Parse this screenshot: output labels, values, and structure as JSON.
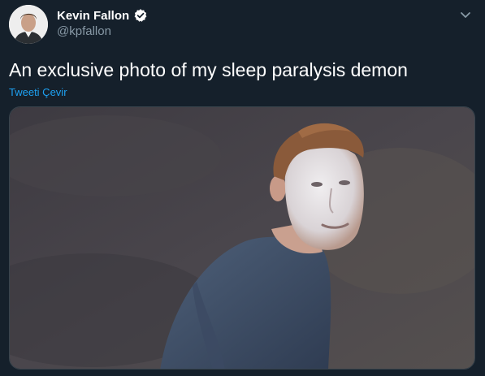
{
  "tweet": {
    "author": {
      "display_name": "Kevin Fallon",
      "handle": "@kpfallon",
      "verified": true,
      "avatar_icon": "profile-photo"
    },
    "text": "An exclusive photo of my sleep paralysis demon",
    "translate_label": "Tweeti Çevir",
    "menu_icon": "chevron-down-icon",
    "media": {
      "type": "photo"
    }
  },
  "colors": {
    "background": "#15202b",
    "link": "#1da1f2",
    "secondary_text": "#8899a6",
    "verified_badge": "#ffffff"
  }
}
